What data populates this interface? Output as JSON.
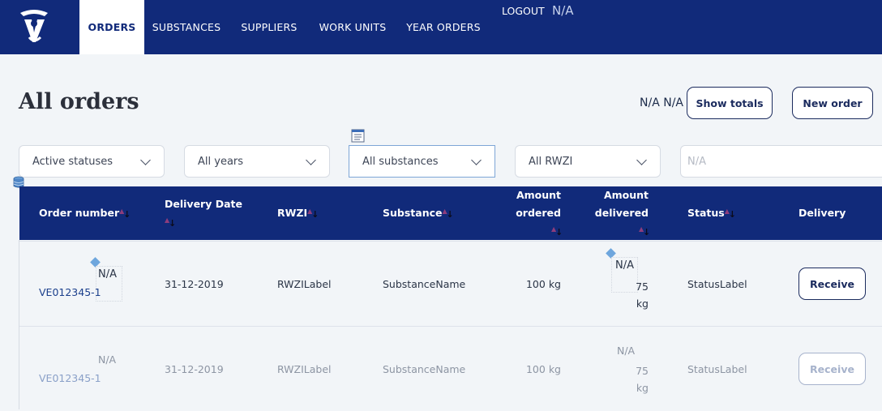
{
  "nav": {
    "tabs": [
      {
        "label": "ORDERS",
        "active": true
      },
      {
        "label": "SUBSTANCES",
        "active": false
      },
      {
        "label": "SUPPLIERS",
        "active": false
      },
      {
        "label": "WORK UNITS",
        "active": false
      },
      {
        "label": "YEAR ORDERS",
        "active": false
      }
    ],
    "logout": "LOGOUT",
    "user": "N/A"
  },
  "header": {
    "title": "All orders",
    "info": "N/A N/A",
    "show_totals": "Show totals",
    "new_order": "New order"
  },
  "filters": {
    "status": "Active statuses",
    "year": "All years",
    "substance": "All substances",
    "rwzi": "All RWZI",
    "search_placeholder": "N/A"
  },
  "table": {
    "columns": {
      "order_number": "Order number",
      "delivery_date": "Delivery Date",
      "rwzi": "RWZI",
      "substance": "Substance",
      "amount_ordered_1": "Amount",
      "amount_ordered_2": "ordered",
      "amount_delivered_1": "Amount",
      "amount_delivered_2": "delivered",
      "status": "Status",
      "delivery": "Delivery"
    },
    "rows": [
      {
        "na": "N/A",
        "order_number": "VE012345-1",
        "delivery_date": "31-12-2019",
        "rwzi": "RWZILabel",
        "substance": "SubstanceName",
        "amount_ordered": "100 kg",
        "delivered_na": "N/A",
        "delivered_value": "75",
        "delivered_unit": "kg",
        "status": "StatusLabel",
        "action": "Receive",
        "enabled": true
      },
      {
        "na": "N/A",
        "order_number": "VE012345-1",
        "delivery_date": "31-12-2019",
        "rwzi": "RWZILabel",
        "substance": "SubstanceName",
        "amount_ordered": "100 kg",
        "delivered_na": "N/A",
        "delivered_value": "75",
        "delivered_unit": "kg",
        "status": "StatusLabel",
        "action": "Receive",
        "enabled": false
      }
    ]
  },
  "colors": {
    "nav_bg": "#112a7a",
    "page_bg": "#f2f5f8",
    "button_border": "#1b2b5e",
    "link": "#1b3f8c"
  }
}
